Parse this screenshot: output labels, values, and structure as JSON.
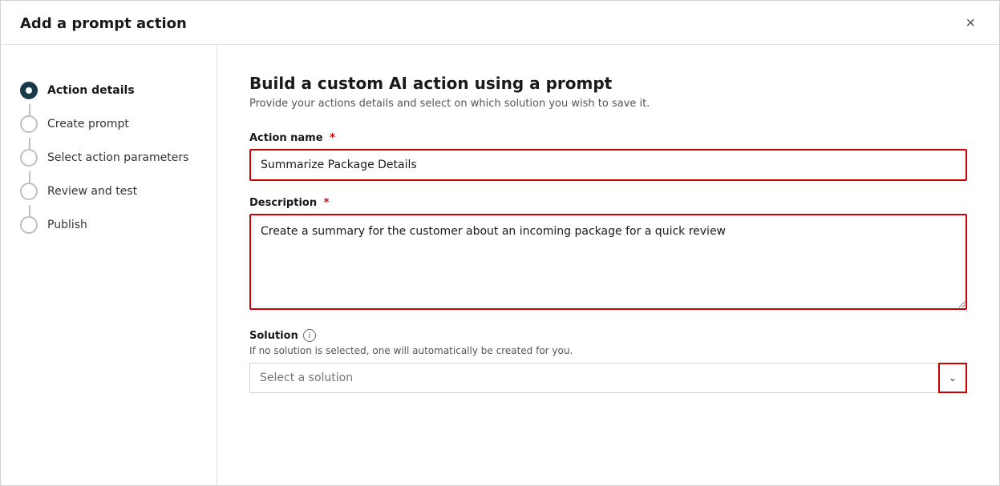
{
  "dialog": {
    "title": "Add a prompt action",
    "close_label": "×"
  },
  "sidebar": {
    "steps": [
      {
        "id": "action-details",
        "label": "Action details",
        "active": true
      },
      {
        "id": "create-prompt",
        "label": "Create prompt",
        "active": false
      },
      {
        "id": "select-action-parameters",
        "label": "Select action parameters",
        "active": false
      },
      {
        "id": "review-and-test",
        "label": "Review and test",
        "active": false
      },
      {
        "id": "publish",
        "label": "Publish",
        "active": false
      }
    ]
  },
  "main": {
    "title": "Build a custom AI action using a prompt",
    "subtitle": "Provide your actions details and select on which solution you wish to save it.",
    "action_name_label": "Action name",
    "action_name_required": "*",
    "action_name_value": "Summarize Package Details",
    "description_label": "Description",
    "description_required": "*",
    "description_value": "Create a summary for the customer about an incoming package for a quick review",
    "solution_label": "Solution",
    "solution_info_tooltip": "i",
    "solution_hint": "If no solution is selected, one will automatically be created for you.",
    "solution_placeholder": "Select a solution"
  }
}
